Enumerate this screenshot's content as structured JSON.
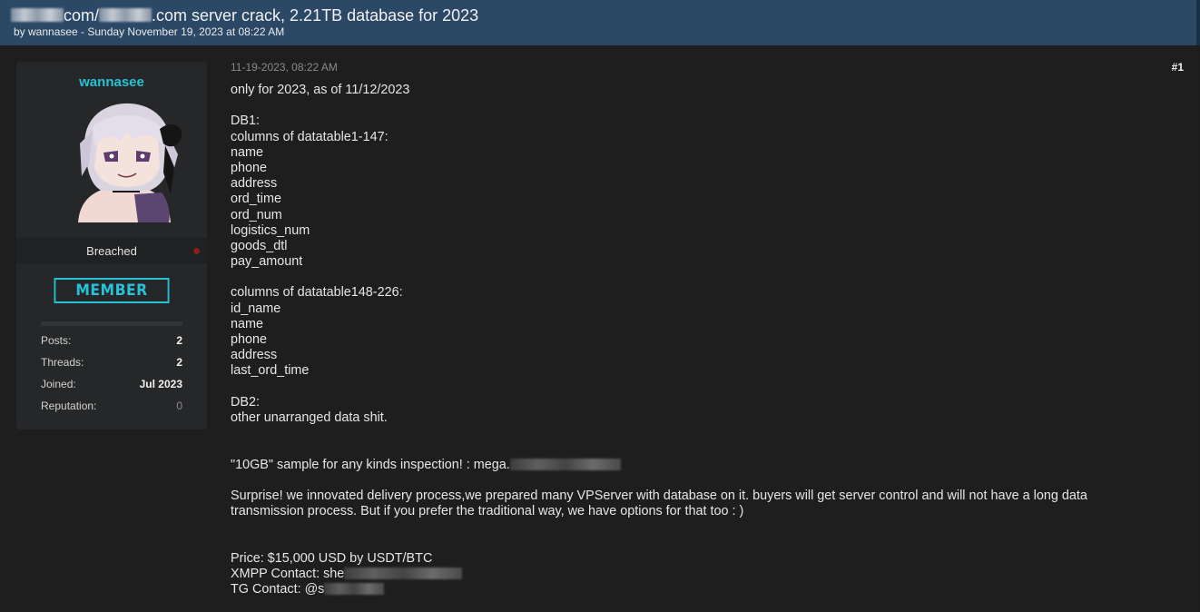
{
  "thread": {
    "title_mid": "com/",
    "title_end": ".com server crack, 2.21TB database for 2023",
    "byline": "by wannasee - Sunday November 19, 2023 at 08:22 AM"
  },
  "user": {
    "name": "wannasee",
    "rank": "Breached",
    "badge": "MEMBER",
    "stats": [
      {
        "label": "Posts:",
        "value": "2"
      },
      {
        "label": "Threads:",
        "value": "2"
      },
      {
        "label": "Joined:",
        "value": "Jul 2023"
      },
      {
        "label": "Reputation:",
        "value": "0"
      }
    ],
    "colors": {
      "accent": "#27c2d6",
      "status_offline": "#8a1e1e"
    }
  },
  "post": {
    "date": "11-19-2023, 08:22 AM",
    "number": "#1",
    "lines": {
      "l1": "only for 2023, as of 11/12/2023",
      "l2": "DB1:",
      "l3": "columns of datatable1-147:",
      "l4": "name",
      "l5": "phone",
      "l6": "address",
      "l7": "ord_time",
      "l8": "ord_num",
      "l9": "logistics_num",
      "l10": "goods_dtl",
      "l11": "pay_amount",
      "l12": "columns of datatable148-226:",
      "l13": "id_name",
      "l14": "name",
      "l15": "phone",
      "l16": "address",
      "l17": "last_ord_time",
      "l18": "DB2:",
      "l19": "other unarranged data shit.",
      "l20": "\"10GB\" sample for any kinds inspection! : mega.",
      "l21": "Surprise! we innovated delivery process,we prepared many VPServer with database on it. buyers will get server control and will not have a long data transmission process. But if you prefer the traditional way, we have options for that too : )",
      "l22": "Price: $15,000 USD  by  USDT/BTC",
      "l23": "XMPP Contact: she",
      "l24": "TG Contact: @s"
    }
  },
  "colors": {
    "header_bg": "#2b4866",
    "page_bg": "#1e1e1e",
    "userbox_bg": "#262728"
  }
}
